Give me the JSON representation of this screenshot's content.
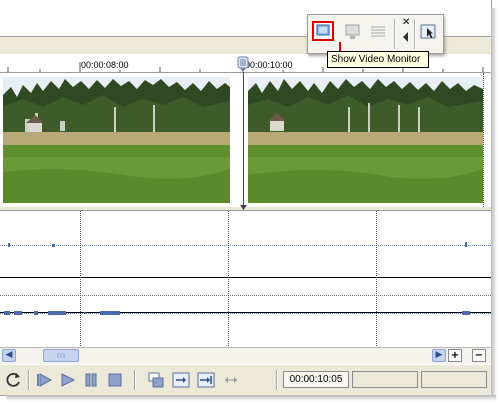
{
  "ruler": {
    "label_8s": "00:00:08:00",
    "label_10s": "00:00:10:00"
  },
  "floating_toolbar": {
    "buttons": [
      {
        "name": "show-video-monitor-button",
        "icon": "video-monitor-icon",
        "selected": true
      },
      {
        "name": "display-button",
        "icon": "display-icon"
      },
      {
        "name": "layout-button",
        "icon": "layout-icon"
      },
      {
        "name": "close-button",
        "icon": "close-icon"
      },
      {
        "name": "collapse-button",
        "icon": "chevron-left-icon"
      },
      {
        "name": "pointer-button",
        "icon": "pointer-icon"
      }
    ],
    "highlight_color": "#e00000"
  },
  "tooltip": {
    "text": "Show Video Monitor"
  },
  "timeline": {
    "current_time": "00:00:10:05"
  },
  "scrollbar": {
    "zoom_in": "+",
    "zoom_out": "−"
  },
  "transport": {
    "buttons": [
      "refresh-icon",
      "play-from-start-icon",
      "play-icon",
      "pause-icon",
      "stop-icon",
      "snapshot-icon",
      "move-forward-icon",
      "move-end-icon",
      "expand-icon"
    ]
  },
  "colors": {
    "background": "#ece9d8",
    "scroll_blue": "#c5d3ef",
    "tooltip_bg": "#ffffe1"
  }
}
